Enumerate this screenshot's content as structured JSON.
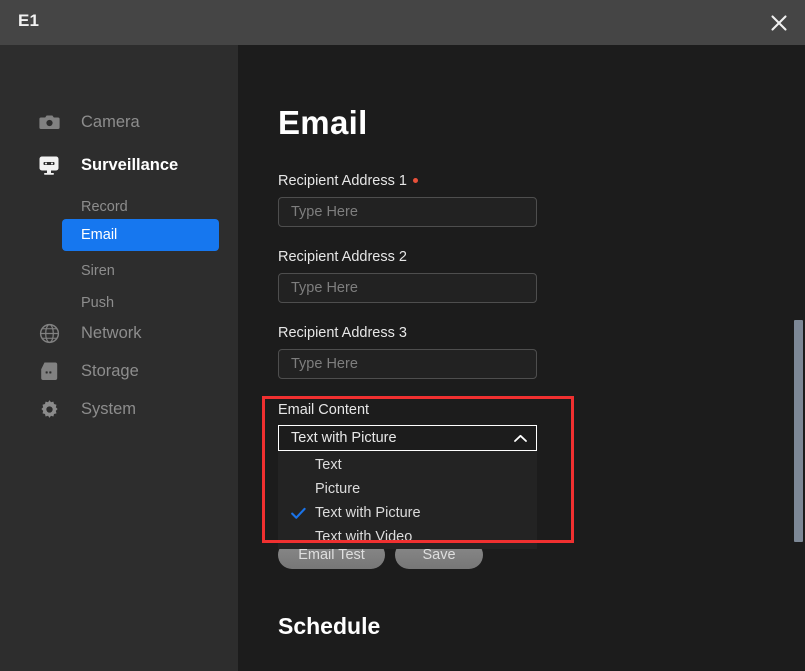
{
  "window": {
    "title": "E1",
    "close_label": "✕",
    "close_icon": "close-icon"
  },
  "sidebar": {
    "items": [
      {
        "id": "camera",
        "label": "Camera",
        "icon": "camera-icon",
        "active": false
      },
      {
        "id": "surveillance",
        "label": "Surveillance",
        "icon": "monitor-icon",
        "active": true
      },
      {
        "id": "network",
        "label": "Network",
        "icon": "globe-icon",
        "active": false
      },
      {
        "id": "storage",
        "label": "Storage",
        "icon": "sd-card-icon",
        "active": false
      },
      {
        "id": "system",
        "label": "System",
        "icon": "gear-icon",
        "active": false
      }
    ],
    "sub_items": [
      {
        "id": "record",
        "label": "Record",
        "selected": false
      },
      {
        "id": "email",
        "label": "Email",
        "selected": true
      },
      {
        "id": "siren",
        "label": "Siren",
        "selected": false
      },
      {
        "id": "push",
        "label": "Push",
        "selected": false
      }
    ],
    "active_color": "#1677ef"
  },
  "main": {
    "page_title": "Email",
    "fields": [
      {
        "label": "Recipient Address 1",
        "required": true,
        "value": "",
        "placeholder": "Type Here"
      },
      {
        "label": "Recipient Address 2",
        "required": false,
        "value": "",
        "placeholder": "Type Here"
      },
      {
        "label": "Recipient Address 3",
        "required": false,
        "value": "",
        "placeholder": "Type Here"
      }
    ],
    "email_content": {
      "label": "Email Content",
      "selected": "Text with Picture",
      "expanded": true,
      "chevron_icon": "chevron-up-icon",
      "check_icon": "check-icon",
      "check_color": "#1a73e8",
      "options": [
        {
          "label": "Text",
          "checked": false
        },
        {
          "label": "Picture",
          "checked": false
        },
        {
          "label": "Text with Picture",
          "checked": true
        },
        {
          "label": "Text with Video",
          "checked": false
        }
      ]
    },
    "buttons": [
      {
        "id": "email-test",
        "label": "Email Test"
      },
      {
        "id": "save",
        "label": "Save"
      }
    ],
    "schedule_title": "Schedule"
  },
  "annotation": {
    "highlight_color": "#f03030"
  },
  "required_marker_color": "#e8503a"
}
